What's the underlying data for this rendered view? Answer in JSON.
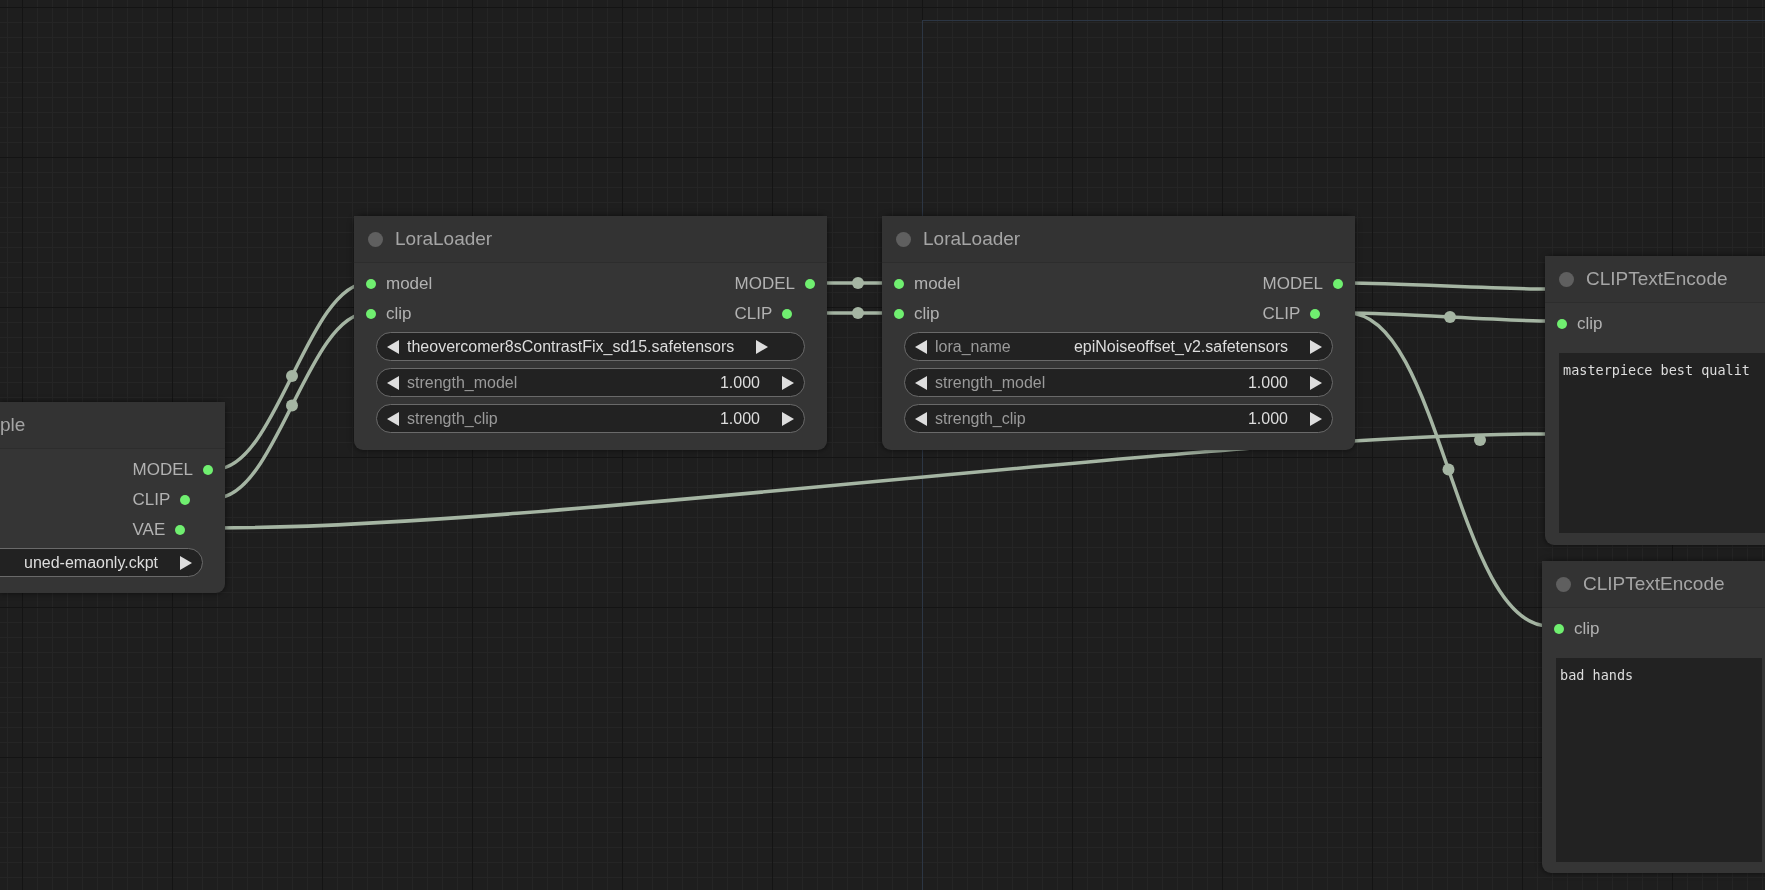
{
  "nodes": [
    {
      "title": "ple",
      "title_dot": false,
      "outputs": [
        "MODEL",
        "CLIP",
        "VAE"
      ],
      "widgets": [
        {
          "kind": "combo",
          "left_arrow": false,
          "value": "uned-emaonly.ckpt"
        }
      ]
    },
    {
      "title": "LoraLoader",
      "title_dot": true,
      "inputs": [
        "model",
        "clip"
      ],
      "outputs": [
        "MODEL",
        "CLIP"
      ],
      "widgets": [
        {
          "kind": "combo",
          "left_arrow": true,
          "value": "theovercomer8sContrastFix_sd15.safetensors"
        },
        {
          "kind": "number",
          "left_arrow": true,
          "label": "strength_model",
          "value": "1.000"
        },
        {
          "kind": "number",
          "left_arrow": true,
          "label": "strength_clip",
          "value": "1.000"
        }
      ]
    },
    {
      "title": "LoraLoader",
      "title_dot": true,
      "inputs": [
        "model",
        "clip"
      ],
      "outputs": [
        "MODEL",
        "CLIP"
      ],
      "widgets": [
        {
          "kind": "combo",
          "left_arrow": true,
          "label": "lora_name",
          "value": "epiNoiseoffset_v2.safetensors"
        },
        {
          "kind": "number",
          "left_arrow": true,
          "label": "strength_model",
          "value": "1.000"
        },
        {
          "kind": "number",
          "left_arrow": true,
          "label": "strength_clip",
          "value": "1.000"
        }
      ]
    },
    {
      "title": "CLIPTextEncode",
      "title_dot": true,
      "inputs": [
        "clip"
      ],
      "widgets": [
        {
          "kind": "text",
          "value": "masterpiece best qualit"
        }
      ]
    },
    {
      "title": "CLIPTextEncode",
      "title_dot": true,
      "inputs": [
        "clip"
      ],
      "widgets": [
        {
          "kind": "text",
          "value": "bad hands"
        }
      ]
    }
  ]
}
